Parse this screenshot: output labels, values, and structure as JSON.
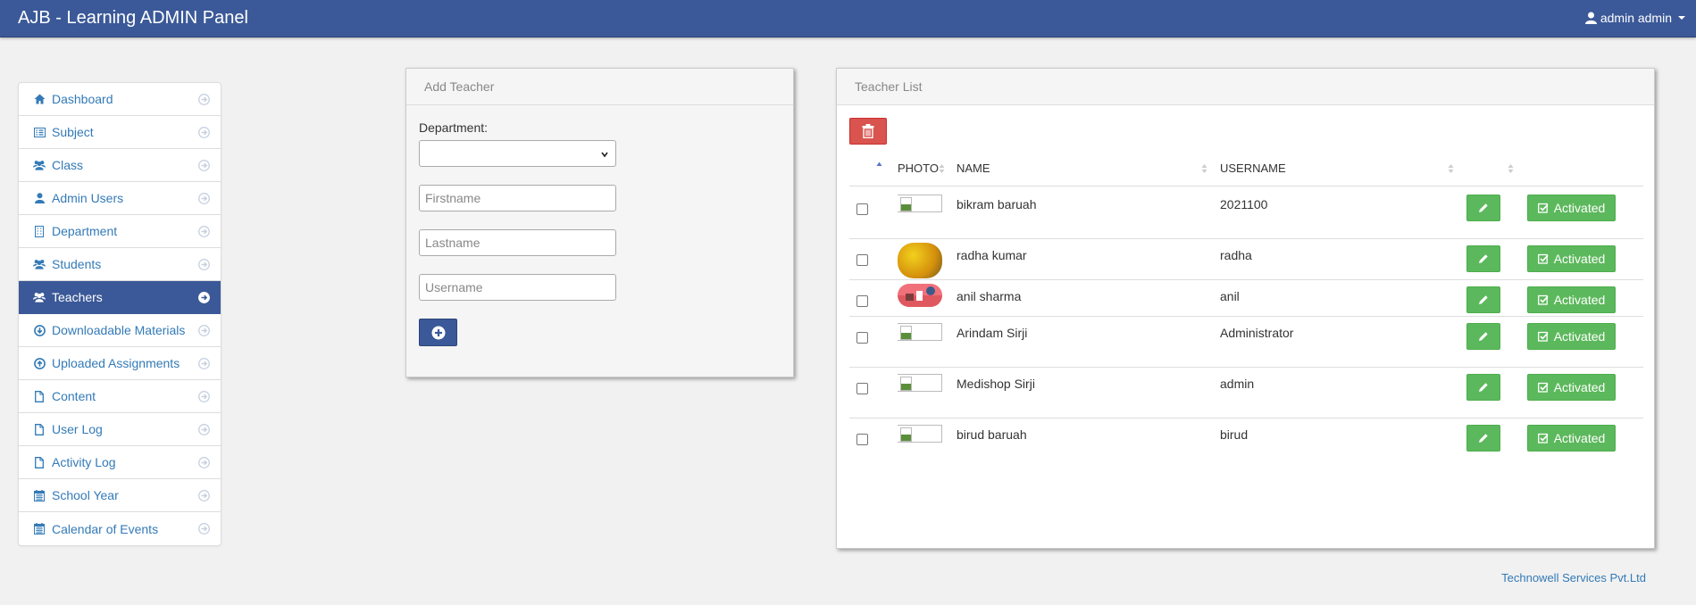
{
  "navbar": {
    "title": "AJB - Learning ADMIN Panel",
    "user_label": "admin admin"
  },
  "sidebar": {
    "items": [
      {
        "label": "Dashboard",
        "icon": "home-icon"
      },
      {
        "label": "Subject",
        "icon": "list-icon"
      },
      {
        "label": "Class",
        "icon": "group-icon"
      },
      {
        "label": "Admin Users",
        "icon": "user-icon"
      },
      {
        "label": "Department",
        "icon": "building-icon"
      },
      {
        "label": "Students",
        "icon": "group-icon"
      },
      {
        "label": "Teachers",
        "icon": "group-icon",
        "active": true
      },
      {
        "label": "Downloadable Materials",
        "icon": "download-icon"
      },
      {
        "label": "Uploaded Assignments",
        "icon": "upload-icon"
      },
      {
        "label": "Content",
        "icon": "file-icon"
      },
      {
        "label": "User Log",
        "icon": "file-icon"
      },
      {
        "label": "Activity Log",
        "icon": "file-icon"
      },
      {
        "label": "School Year",
        "icon": "calendar-icon"
      },
      {
        "label": "Calendar of Events",
        "icon": "calendar-icon"
      }
    ]
  },
  "add_teacher": {
    "heading": "Add Teacher",
    "department_label": "Department:",
    "department_value": "",
    "firstname_placeholder": "Firstname",
    "lastname_placeholder": "Lastname",
    "username_placeholder": "Username"
  },
  "teacher_list": {
    "heading": "Teacher List",
    "columns": [
      "PHOTO",
      "NAME",
      "USERNAME"
    ],
    "rows": [
      {
        "name": "bikram baruah",
        "username": "2021100",
        "photo": "broken",
        "status": "Activated"
      },
      {
        "name": "radha kumar",
        "username": "radha",
        "photo": "flower",
        "status": "Activated"
      },
      {
        "name": "anil sharma",
        "username": "anil",
        "photo": "pink",
        "status": "Activated"
      },
      {
        "name": "Arindam Sirji",
        "username": "Administrator",
        "photo": "broken",
        "status": "Activated"
      },
      {
        "name": "Medishop Sirji",
        "username": "admin",
        "photo": "broken",
        "status": "Activated"
      },
      {
        "name": "birud baruah",
        "username": "birud",
        "photo": "broken",
        "status": "Activated"
      }
    ]
  },
  "footer": {
    "text": "Technowell Services Pvt.Ltd"
  },
  "colors": {
    "navbar": "#3b5998",
    "link": "#337ab7",
    "success": "#5cb85c",
    "danger": "#d9534f"
  }
}
